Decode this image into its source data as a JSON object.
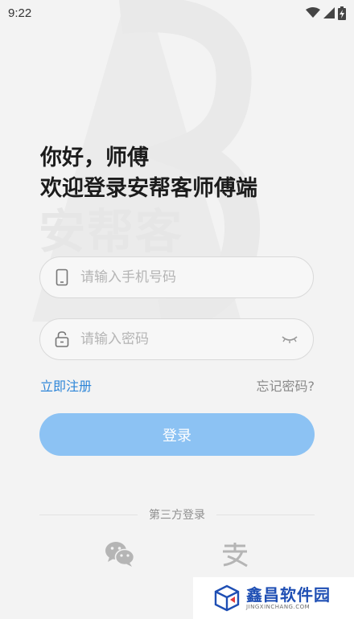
{
  "status_bar": {
    "time": "9:22"
  },
  "watermark": {
    "text": "安帮客"
  },
  "greeting": {
    "line1": "你好，师傅",
    "line2": "欢迎登录安帮客师傅端"
  },
  "phone_field": {
    "placeholder": "请输入手机号码",
    "value": ""
  },
  "password_field": {
    "placeholder": "请输入密码",
    "value": ""
  },
  "links": {
    "register": "立即注册",
    "forgot": "忘记密码?"
  },
  "login_button": {
    "label": "登录"
  },
  "third_party": {
    "label": "第三方登录"
  },
  "brand": {
    "name": "鑫昌软件园",
    "url": "JINGXINCHANG.COM"
  },
  "colors": {
    "accent": "#2e86d8",
    "login_button": "#8cc2f3",
    "background": "#f3f3f3",
    "wechat": "#b8b8b8"
  },
  "icons": {
    "wifi": "wifi-icon",
    "signal": "signal-icon",
    "battery": "battery-icon",
    "phone": "phone-icon",
    "lock": "lock-icon",
    "eye": "eye-closed-icon",
    "wechat": "wechat-icon",
    "alipay": "alipay-icon"
  }
}
